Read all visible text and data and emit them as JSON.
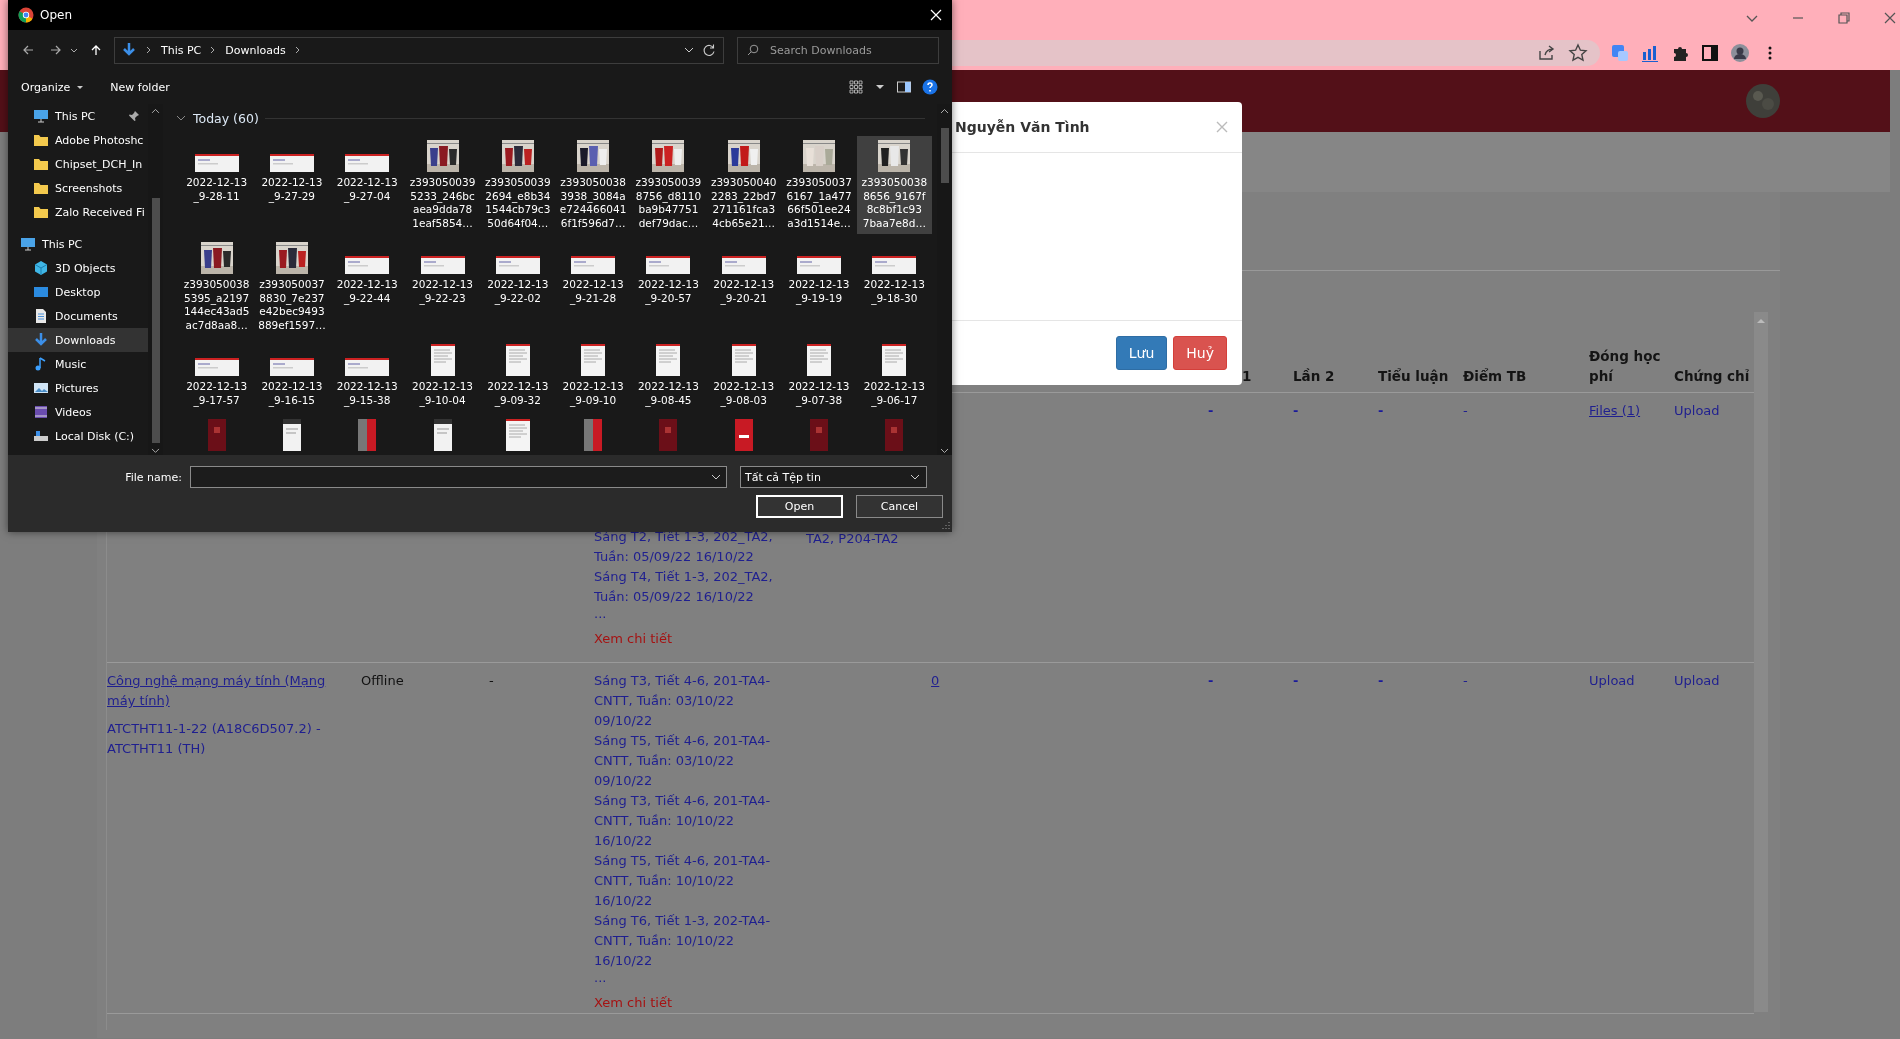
{
  "dialog": {
    "title": "Open",
    "path": [
      "This PC",
      "Downloads"
    ],
    "search": {
      "placeholder": "Search Downloads"
    },
    "commands": [
      "Organize",
      "New folder"
    ],
    "nav_pane": {
      "quick_access": [
        {
          "label": "This PC",
          "kind": "pc",
          "pinned": true,
          "selected": false
        },
        {
          "label": "Adobe Photoshc",
          "kind": "folder",
          "pinned": false,
          "selected": false
        },
        {
          "label": "Chipset_DCH_In",
          "kind": "folder",
          "pinned": false,
          "selected": false
        },
        {
          "label": "Screenshots",
          "kind": "folder",
          "pinned": false,
          "selected": false
        },
        {
          "label": "Zalo Received Fi",
          "kind": "folder",
          "pinned": false,
          "selected": false
        }
      ],
      "this_pc": {
        "label": "This PC",
        "kind": "pc",
        "selected": false,
        "children": [
          {
            "label": "3D Objects",
            "kind": "objects",
            "selected": false
          },
          {
            "label": "Desktop",
            "kind": "desktop",
            "selected": false
          },
          {
            "label": "Documents",
            "kind": "documents",
            "selected": false
          },
          {
            "label": "Downloads",
            "kind": "downloads",
            "selected": true
          },
          {
            "label": "Music",
            "kind": "music",
            "selected": false
          },
          {
            "label": "Pictures",
            "kind": "pictures",
            "selected": false
          },
          {
            "label": "Videos",
            "kind": "videos",
            "selected": false
          },
          {
            "label": "Local Disk (C:)",
            "kind": "disk",
            "selected": false
          }
        ]
      }
    },
    "group": {
      "label": "Today (60)",
      "expanded": true
    },
    "files": [
      {
        "kind": "screenshot",
        "lines": [
          "2022-12-13",
          "_9-28-11"
        ],
        "selected": false
      },
      {
        "kind": "screenshot",
        "lines": [
          "2022-12-13",
          "_9-27-29"
        ],
        "selected": false
      },
      {
        "kind": "screenshot",
        "lines": [
          "2022-12-13",
          "_9-27-04"
        ],
        "selected": false
      },
      {
        "lines": [
          "z393050039",
          "5233_246bc",
          "aea9dda78",
          "1eaf5854…"
        ],
        "selected": false
      },
      {
        "lines": [
          "z393050039",
          "2694_e8b34",
          "1544cb79c3",
          "50d64f04…"
        ],
        "selected": false
      },
      {
        "lines": [
          "z393050038",
          "3938_3084a",
          "e724466041",
          "6f1f596d7…"
        ],
        "selected": false
      },
      {
        "lines": [
          "z393050039",
          "8756_d8110",
          "ba9b47751",
          "def79dac…"
        ],
        "selected": false
      },
      {
        "lines": [
          "z393050040",
          "2283_22bd7",
          "271161fca3",
          "4cb65e21…"
        ],
        "selected": false
      },
      {
        "lines": [
          "z393050037",
          "6167_1a477",
          "66f501ee24",
          "a3d1514e…"
        ],
        "selected": false
      },
      {
        "lines": [
          "z393050038",
          "8656_9167f",
          "8c8bf1c93",
          "7baa7e8d…"
        ],
        "selected": true
      },
      {
        "lines": [
          "z393050038",
          "5395_a2197",
          "144ec43ad5",
          "ac7d8aa8…"
        ],
        "selected": false
      },
      {
        "lines": [
          "z393050037",
          "8830_7e237",
          "e42bec9493",
          "889ef1597…"
        ],
        "selected": false
      },
      {
        "kind": "screenshot",
        "lines": [
          "2022-12-13",
          "_9-22-44"
        ],
        "selected": false
      },
      {
        "kind": "screenshot",
        "lines": [
          "2022-12-13",
          "_9-22-23"
        ],
        "selected": false
      },
      {
        "kind": "screenshot",
        "lines": [
          "2022-12-13",
          "_9-22-02"
        ],
        "selected": false
      },
      {
        "kind": "screenshot",
        "lines": [
          "2022-12-13",
          "_9-21-28"
        ],
        "selected": false
      },
      {
        "kind": "screenshot",
        "lines": [
          "2022-12-13",
          "_9-20-57"
        ],
        "selected": false
      },
      {
        "kind": "screenshot",
        "lines": [
          "2022-12-13",
          "_9-20-21"
        ],
        "selected": false
      },
      {
        "kind": "screenshot",
        "lines": [
          "2022-12-13",
          "_9-19-19"
        ],
        "selected": false
      },
      {
        "kind": "screenshot",
        "lines": [
          "2022-12-13",
          "_9-18-30"
        ],
        "selected": false
      },
      {
        "kind": "screenshot",
        "lines": [
          "2022-12-13",
          "_9-17-57"
        ],
        "selected": false
      },
      {
        "kind": "screenshot",
        "lines": [
          "2022-12-13",
          "_9-16-15"
        ],
        "selected": false
      },
      {
        "kind": "screenshot",
        "lines": [
          "2022-12-13",
          "_9-15-38"
        ],
        "selected": false
      },
      {
        "kind": "page",
        "lines": [
          "2022-12-13",
          "_9-10-04"
        ],
        "selected": false
      },
      {
        "kind": "page",
        "lines": [
          "2022-12-13",
          "_9-09-32"
        ],
        "selected": false
      },
      {
        "kind": "page",
        "lines": [
          "2022-12-13",
          "_9-09-10"
        ],
        "selected": false
      },
      {
        "kind": "page",
        "lines": [
          "2022-12-13",
          "_9-08-45"
        ],
        "selected": false
      },
      {
        "kind": "page",
        "lines": [
          "2022-12-13",
          "_9-08-03"
        ],
        "selected": false
      },
      {
        "kind": "page",
        "lines": [
          "2022-12-13",
          "_9-07-38"
        ],
        "selected": false
      },
      {
        "kind": "page",
        "lines": [
          "2022-12-13",
          "_9-06-17"
        ],
        "selected": false
      },
      {
        "kind": "app-dark",
        "selected": false
      },
      {
        "kind": "phone",
        "selected": false
      },
      {
        "kind": "app-split",
        "selected": false
      },
      {
        "kind": "phone",
        "selected": false
      },
      {
        "kind": "page",
        "selected": false
      },
      {
        "kind": "app-split",
        "selected": false
      },
      {
        "kind": "app-dark",
        "selected": false
      },
      {
        "kind": "app-red",
        "selected": false
      },
      {
        "kind": "app-dark",
        "selected": false
      },
      {
        "kind": "app-dark",
        "selected": false
      }
    ],
    "file_name": {
      "label": "File name:"
    },
    "file_type": {
      "value": "Tất cả Tệp tin"
    },
    "buttons": [
      "Open",
      "Cancel"
    ]
  },
  "modal": {
    "title": "Nguyễn Văn Tình",
    "buttons": [
      {
        "label": "Lưu",
        "kind": "primary"
      },
      {
        "label": "Huỷ",
        "kind": "danger"
      }
    ]
  },
  "table": {
    "columns": [
      "1",
      "Lần 2",
      "Tiểu luận",
      "Điểm TB",
      "Đóng học phí",
      "Chứng chỉ"
    ],
    "rows": [
      {
        "schedule": [
          "Sáng T2, Tiết 1-3, 202_TA2, Tuần: 05/09/22 16/10/22",
          "Sáng T4, Tiết 1-3, 202_TA2, Tuần: 05/09/22 16/10/22"
        ],
        "more": "...",
        "details": "Xem chi tiết",
        "room": "TA2, P204-TA2",
        "scores": [
          "-",
          "-",
          "-",
          "-"
        ],
        "fee": "Files (1)",
        "certificate": "Upload"
      },
      {
        "course": "Công nghệ mạng máy tính (Mạng máy tính)",
        "class": "ATCTHT11-1-22 (A18C6D507.2) - ATCTHT11 (TH)",
        "mode": "Offline",
        "column_3": "-",
        "schedule": [
          "Sáng T3, Tiết 4-6, 201-TA4-CNTT, Tuần: 03/10/22 09/10/22",
          "Sáng T5, Tiết 4-6, 201-TA4-CNTT, Tuần: 03/10/22 09/10/22",
          "Sáng T3, Tiết 4-6, 201-TA4-CNTT, Tuần: 10/10/22 16/10/22",
          "Sáng T5, Tiết 4-6, 201-TA4-CNTT, Tuần: 10/10/22 16/10/22",
          "Sáng T6, Tiết 1-3, 202-TA4-CNTT, Tuần: 10/10/22 16/10/22"
        ],
        "more": "...",
        "details": "Xem chi tiết",
        "column_6": "0",
        "scores": [
          "-",
          "-",
          "-",
          "-"
        ],
        "fee": "Upload",
        "certificate": "Upload"
      }
    ]
  }
}
